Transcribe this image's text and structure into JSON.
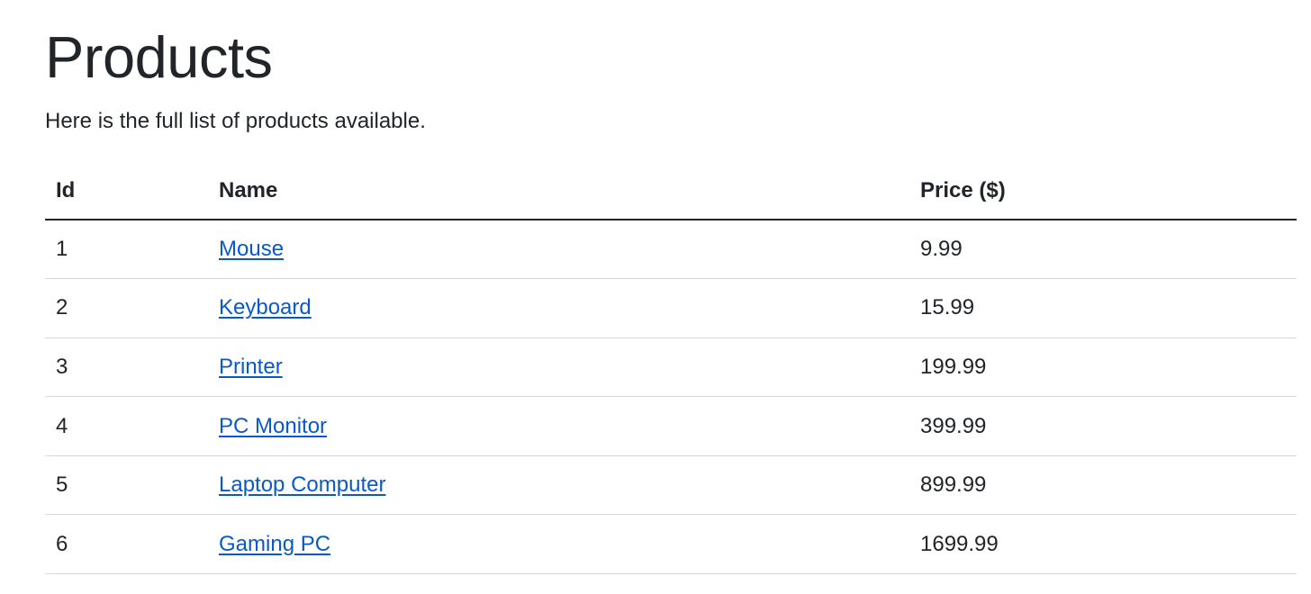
{
  "page": {
    "title": "Products",
    "intro": "Here is the full list of products available."
  },
  "table": {
    "headers": [
      "Id",
      "Name",
      "Price ($)"
    ],
    "rows": [
      {
        "id": "1",
        "name": "Mouse",
        "price": "9.99"
      },
      {
        "id": "2",
        "name": "Keyboard",
        "price": "15.99"
      },
      {
        "id": "3",
        "name": "Printer",
        "price": "199.99"
      },
      {
        "id": "4",
        "name": "PC Monitor",
        "price": "399.99"
      },
      {
        "id": "5",
        "name": "Laptop Computer",
        "price": "899.99"
      },
      {
        "id": "6",
        "name": "Gaming PC",
        "price": "1699.99"
      }
    ]
  },
  "colors": {
    "text": "#212529",
    "link": "#0a58ca",
    "row_border": "#d6d8db",
    "header_border": "#212529",
    "background": "#ffffff"
  }
}
